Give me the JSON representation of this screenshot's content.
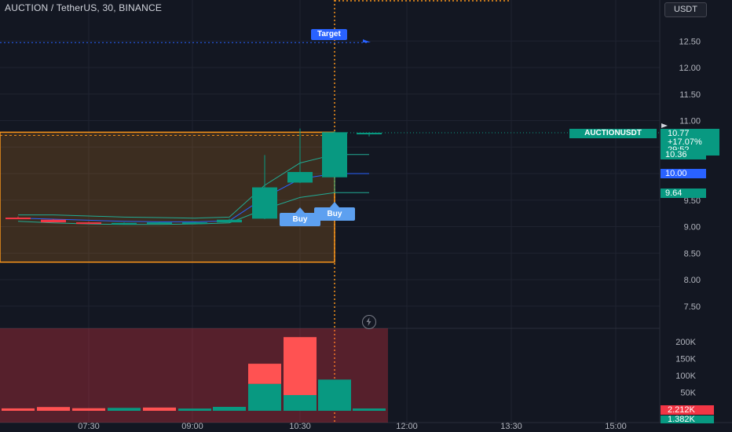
{
  "header": {
    "symbol_title": "AUCTION / TetherUS, 30, BINANCE",
    "currency_button": "USDT"
  },
  "labels": {
    "target": "Target",
    "buy_1": "Buy",
    "buy_2": "Buy",
    "symbol_tag": "AUCTIONUSDT",
    "last_price": "10.77",
    "change_pct": "+17.07%",
    "countdown": "29:52",
    "level_upper": "10.36",
    "level_mid": "10.00",
    "level_lower": "9.64",
    "vol_1": "2.212K",
    "vol_2": "1.382K"
  },
  "colors": {
    "background": "#131722",
    "up": "#089981",
    "down": "#f23645",
    "accent_blue": "#2962ff",
    "zone_border": "#f7931a",
    "buy_label": "#5da0f0"
  },
  "icons": [
    "lightning-bolt-icon"
  ],
  "chart_data": [
    {
      "type": "candlestick",
      "title": "AUCTION / TetherUS, 30, BINANCE",
      "x_tick_labels": [
        "07:30",
        "09:00",
        "10:30",
        "12:00",
        "13:30",
        "15:00"
      ],
      "y_tick_labels": [
        "7.50",
        "8.00",
        "8.50",
        "9.00",
        "9.50",
        "10.00",
        "10.50",
        "11.00",
        "11.50",
        "12.00",
        "12.50"
      ],
      "ylim": [
        7.25,
        13.3
      ],
      "y_axis_side": "right",
      "candles": [
        {
          "open": 9.17,
          "high": 9.19,
          "low": 9.14,
          "close": 9.14
        },
        {
          "open": 9.13,
          "high": 9.14,
          "low": 9.08,
          "close": 9.08
        },
        {
          "open": 9.08,
          "high": 9.09,
          "low": 9.06,
          "close": 9.06
        },
        {
          "open": 9.06,
          "high": 9.08,
          "low": 9.05,
          "close": 9.07
        },
        {
          "open": 9.07,
          "high": 9.09,
          "low": 9.06,
          "close": 9.08
        },
        {
          "open": 9.07,
          "high": 9.09,
          "low": 9.06,
          "close": 9.08
        },
        {
          "open": 9.08,
          "high": 9.15,
          "low": 9.07,
          "close": 9.13
        },
        {
          "open": 9.15,
          "high": 10.35,
          "low": 9.14,
          "close": 9.74
        },
        {
          "open": 9.83,
          "high": 10.85,
          "low": 9.82,
          "close": 10.03
        },
        {
          "open": 9.93,
          "high": 10.8,
          "low": 9.65,
          "close": 10.78
        },
        {
          "open": 10.77,
          "high": 10.78,
          "low": 10.7,
          "close": 10.77
        }
      ],
      "horizontal_lines": [
        {
          "label": "Target",
          "value": 12.47
        },
        {
          "value": 10.77
        }
      ],
      "zone": {
        "top": 10.78,
        "bottom": 8.33
      }
    },
    {
      "type": "bar",
      "title": "Volume",
      "y_tick_labels": [
        "50K",
        "100K",
        "150K",
        "200K"
      ],
      "ylim": [
        0,
        230000
      ],
      "values": [
        {
          "total": 2500,
          "up": 0,
          "color": "down"
        },
        {
          "total": 6500,
          "up": 0,
          "color": "down"
        },
        {
          "total": 3000,
          "up": 0,
          "color": "down"
        },
        {
          "total": 4000,
          "up": 4000,
          "color": "up"
        },
        {
          "total": 5000,
          "up": 0,
          "color": "down"
        },
        {
          "total": 2000,
          "up": 2000,
          "color": "up"
        },
        {
          "total": 7000,
          "up": 7000,
          "color": "up"
        },
        {
          "total": 135000,
          "up": 75000,
          "color": "split"
        },
        {
          "total": 214000,
          "up": 42000,
          "color": "split"
        },
        {
          "total": 88000,
          "up": 88000,
          "color": "up"
        },
        {
          "total": 2212,
          "up": 2212,
          "color": "up"
        }
      ]
    }
  ]
}
